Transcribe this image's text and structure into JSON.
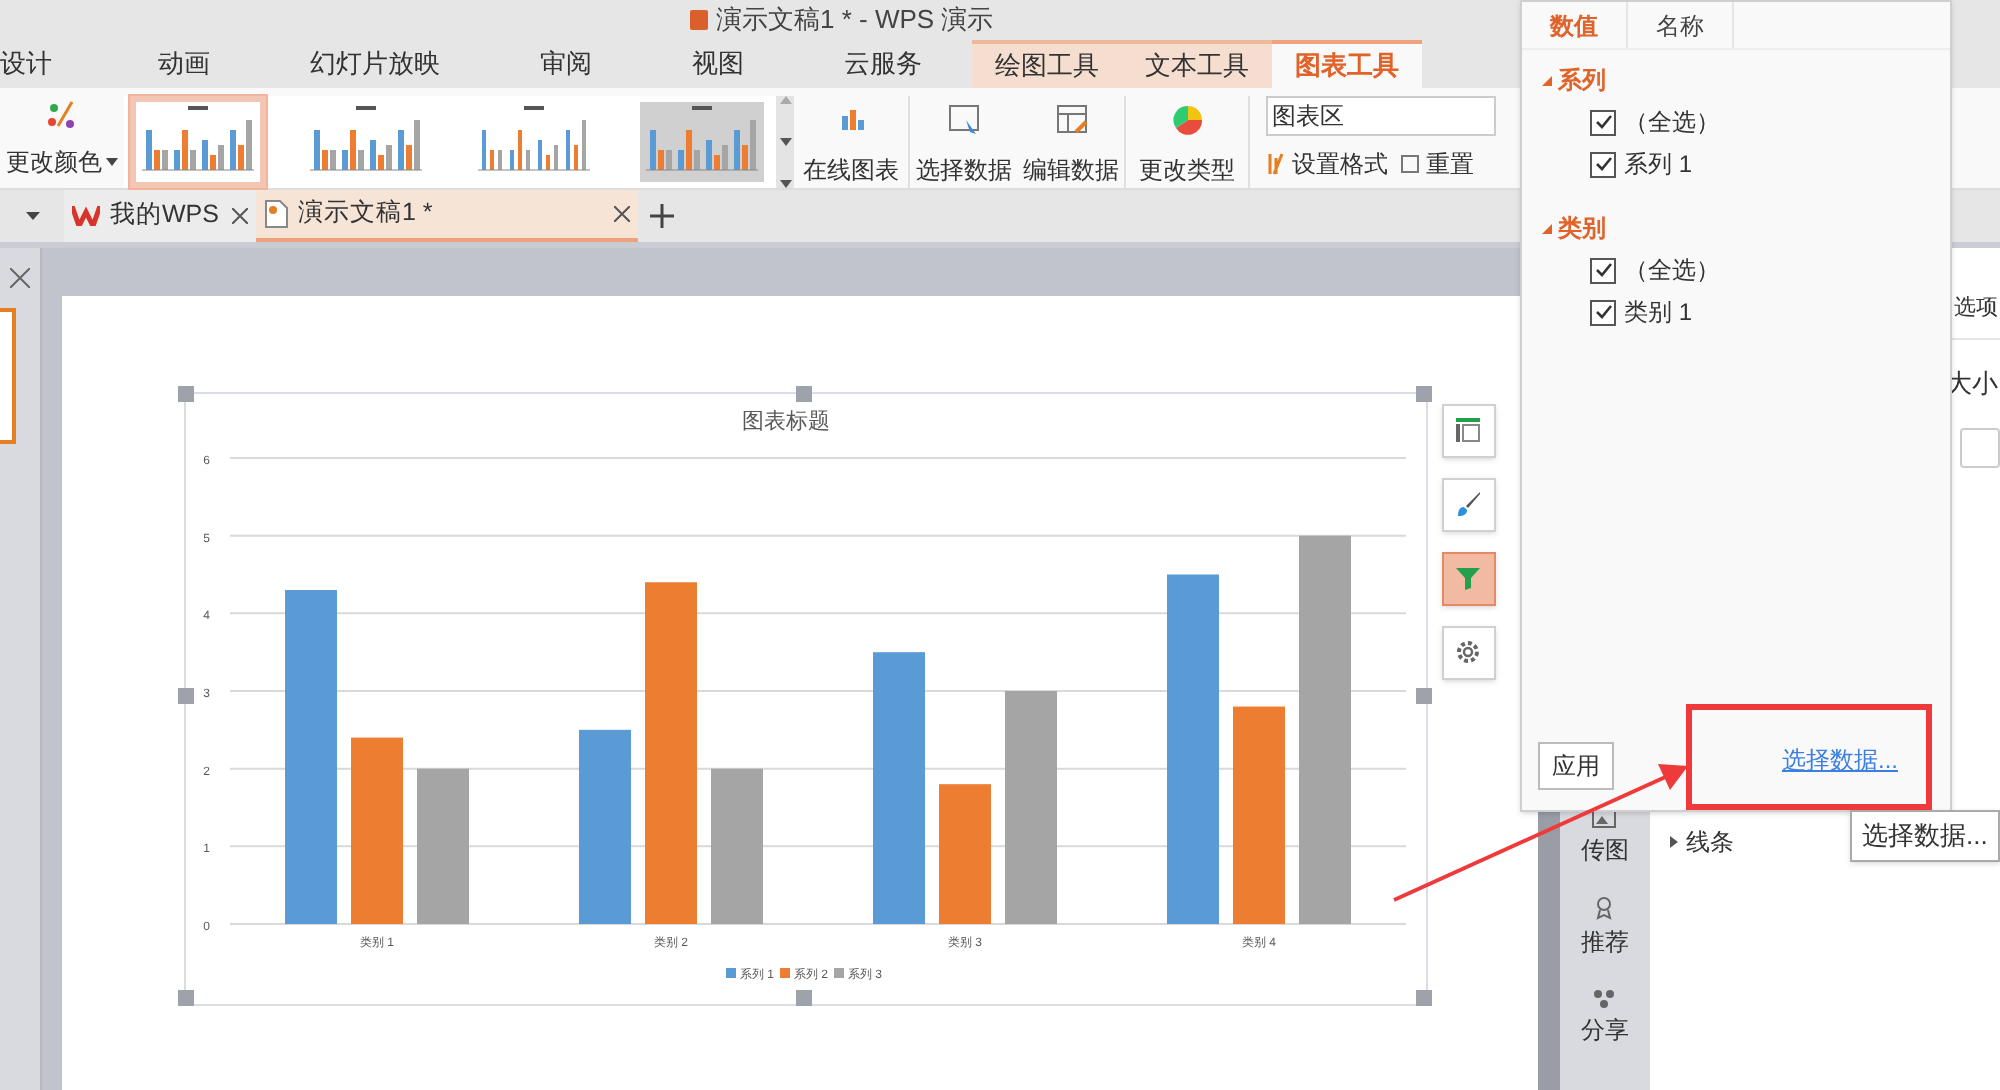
{
  "window": {
    "title": "演示文稿1 * - WPS 演示"
  },
  "ribbon_tabs": [
    {
      "label": "设计",
      "selected": false,
      "kind": "normal"
    },
    {
      "label": "动画",
      "selected": false,
      "kind": "normal"
    },
    {
      "label": "幻灯片放映",
      "selected": false,
      "kind": "normal"
    },
    {
      "label": "审阅",
      "selected": false,
      "kind": "normal"
    },
    {
      "label": "视图",
      "selected": false,
      "kind": "normal"
    },
    {
      "label": "云服务",
      "selected": false,
      "kind": "normal"
    },
    {
      "label": "绘图工具",
      "selected": false,
      "kind": "contextual"
    },
    {
      "label": "文本工具",
      "selected": false,
      "kind": "contextual"
    },
    {
      "label": "图表工具",
      "selected": true,
      "kind": "contextual"
    }
  ],
  "ribbon": {
    "change_color": "更改颜色",
    "styles": [
      {
        "selected": true
      },
      {
        "selected": false
      },
      {
        "selected": false
      },
      {
        "selected": false
      }
    ],
    "online_chart": "在线图表",
    "select_data": "选择数据",
    "edit_data": "编辑数据",
    "change_type": "更改类型",
    "element_dropdown": {
      "value": "图表区"
    },
    "format": "设置格式",
    "reset": "重置"
  },
  "doc_tabs": [
    {
      "label": "我的WPS",
      "selected": false,
      "kind": "home"
    },
    {
      "label": "演示文稿1 *",
      "selected": true,
      "kind": "document"
    }
  ],
  "chart": {
    "chart_data": {
      "type": "bar",
      "title": "图表标题",
      "categories": [
        "类别 1",
        "类别 2",
        "类别 3",
        "类别 4"
      ],
      "series": [
        {
          "name": "系列 1",
          "color": "#5b9bd5",
          "values": [
            4.3,
            2.5,
            3.5,
            4.5
          ]
        },
        {
          "name": "系列 2",
          "color": "#ed7d31",
          "values": [
            2.4,
            4.4,
            1.8,
            2.8
          ]
        },
        {
          "name": "系列 3",
          "color": "#a5a5a5",
          "values": [
            2,
            2,
            3,
            5
          ]
        }
      ],
      "ylim": [
        0,
        6
      ],
      "yticks": [
        0,
        1,
        2,
        3,
        4,
        5,
        6
      ],
      "grid": true,
      "legend": true
    },
    "tools": [
      {
        "kind": "elements",
        "selected": false
      },
      {
        "kind": "style",
        "selected": false
      },
      {
        "kind": "filter",
        "selected": true
      },
      {
        "kind": "settings",
        "selected": false
      }
    ]
  },
  "filter_popup": {
    "tabs": [
      {
        "label": "数值",
        "selected": true
      },
      {
        "label": "名称",
        "selected": false
      }
    ],
    "groups": [
      {
        "label": "系列",
        "expanded": true,
        "items": [
          {
            "label": "（全选）",
            "checked": true
          },
          {
            "label": "系列 1",
            "checked": true
          }
        ]
      },
      {
        "label": "类别",
        "expanded": true,
        "items": [
          {
            "label": "（全选）",
            "checked": true
          },
          {
            "label": "类别 1",
            "checked": true
          }
        ]
      }
    ],
    "apply": "应用",
    "select_data_link": "选择数据..."
  },
  "tooltip": "选择数据...",
  "side_strip": [
    {
      "label": "传图",
      "kind": "upload"
    },
    {
      "label": "推荐",
      "kind": "recommend"
    },
    {
      "label": "分享",
      "kind": "share"
    }
  ],
  "format_panel": {
    "tab_fragment": "选项",
    "size_label": "大小",
    "lines_section": "线条"
  }
}
